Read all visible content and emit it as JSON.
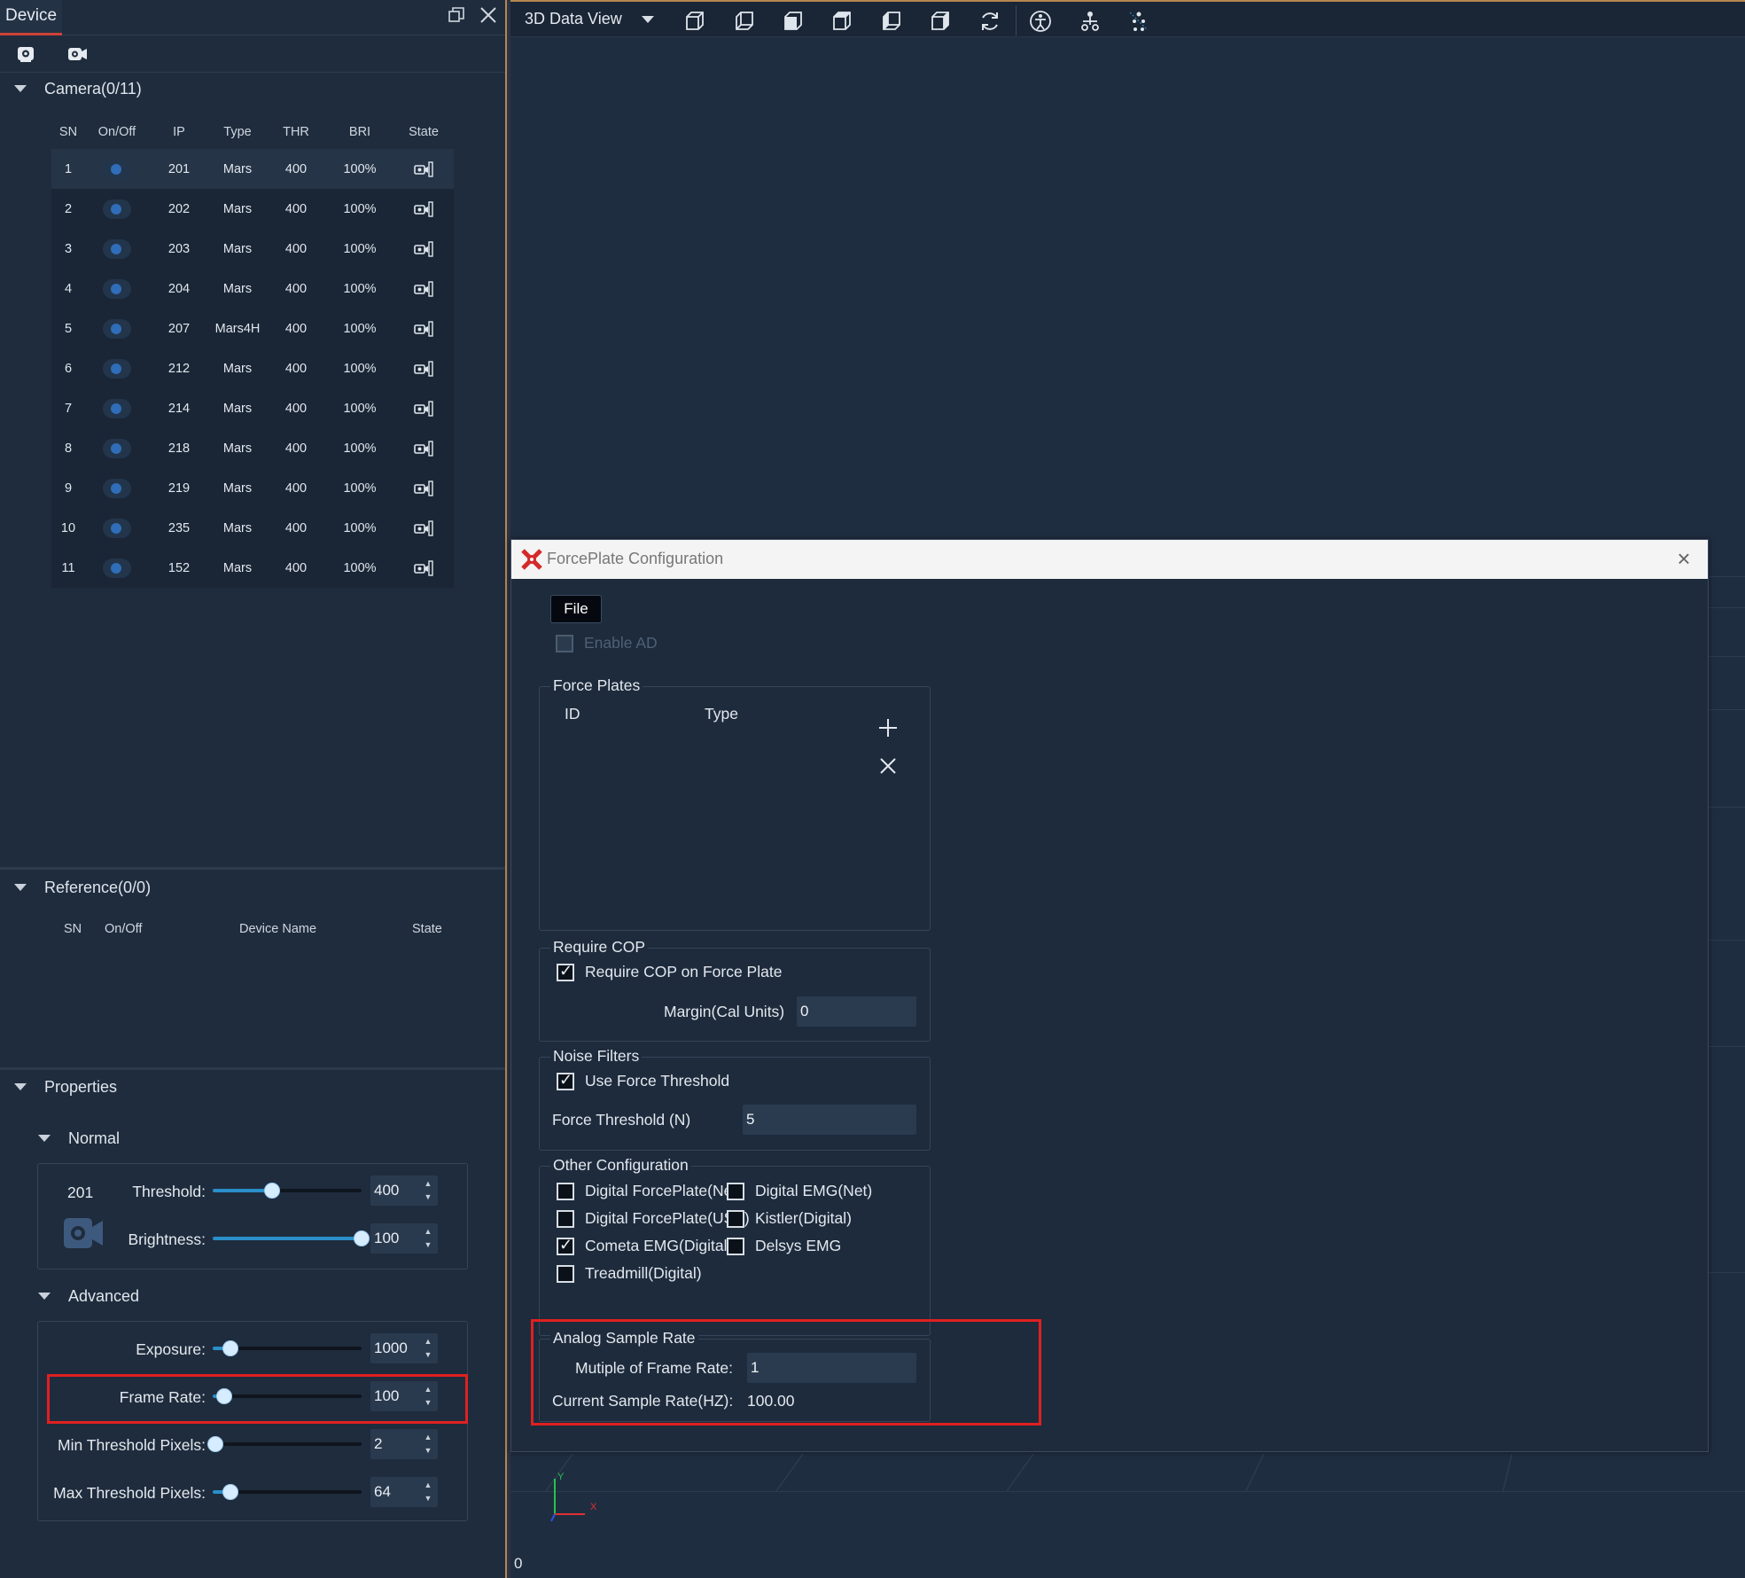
{
  "left_panel": {
    "tab_title": "Device",
    "camera_section": {
      "title": "Camera(0/11)",
      "columns": [
        "SN",
        "On/Off",
        "IP",
        "Type",
        "THR",
        "BRI",
        "State"
      ],
      "rows": [
        {
          "sn": "1",
          "ip": "201",
          "type": "Mars",
          "thr": "400",
          "bri": "100%"
        },
        {
          "sn": "2",
          "ip": "202",
          "type": "Mars",
          "thr": "400",
          "bri": "100%"
        },
        {
          "sn": "3",
          "ip": "203",
          "type": "Mars",
          "thr": "400",
          "bri": "100%"
        },
        {
          "sn": "4",
          "ip": "204",
          "type": "Mars",
          "thr": "400",
          "bri": "100%"
        },
        {
          "sn": "5",
          "ip": "207",
          "type": "Mars4H",
          "thr": "400",
          "bri": "100%"
        },
        {
          "sn": "6",
          "ip": "212",
          "type": "Mars",
          "thr": "400",
          "bri": "100%"
        },
        {
          "sn": "7",
          "ip": "214",
          "type": "Mars",
          "thr": "400",
          "bri": "100%"
        },
        {
          "sn": "8",
          "ip": "218",
          "type": "Mars",
          "thr": "400",
          "bri": "100%"
        },
        {
          "sn": "9",
          "ip": "219",
          "type": "Mars",
          "thr": "400",
          "bri": "100%"
        },
        {
          "sn": "10",
          "ip": "235",
          "type": "Mars",
          "thr": "400",
          "bri": "100%"
        },
        {
          "sn": "11",
          "ip": "152",
          "type": "Mars",
          "thr": "400",
          "bri": "100%"
        }
      ]
    },
    "reference_section": {
      "title": "Reference(0/0)",
      "columns": [
        "SN",
        "On/Off",
        "Device Name",
        "State"
      ]
    },
    "properties": {
      "title": "Properties",
      "normal": {
        "title": "Normal",
        "camera_id": "201",
        "threshold_label": "Threshold:",
        "threshold_value": "400",
        "threshold_level": 0.4,
        "brightness_label": "Brightness:",
        "brightness_value": "100",
        "brightness_level": 1.0
      },
      "advanced": {
        "title": "Advanced",
        "exposure_label": "Exposure:",
        "exposure_value": "1000",
        "exposure_level": 0.12,
        "frame_rate_label": "Frame Rate:",
        "frame_rate_value": "100",
        "frame_rate_level": 0.08,
        "min_threshold_label": "Min Threshold Pixels:",
        "min_threshold_value": "2",
        "min_threshold_level": 0.02,
        "max_threshold_label": "Max Threshold Pixels:",
        "max_threshold_value": "64",
        "max_threshold_level": 0.12
      }
    }
  },
  "view": {
    "mode_label": "3D Data View",
    "axis_zero": "0",
    "axis_x": "X",
    "axis_y": "Y"
  },
  "dialog": {
    "title": "ForcePlate Configuration",
    "file_menu": "File",
    "enable_ad": "Enable AD",
    "force_plates": {
      "title": "Force Plates",
      "col_id": "ID",
      "col_type": "Type"
    },
    "require_cop": {
      "title": "Require COP",
      "checkbox": "Require COP on Force Plate",
      "margin_label": "Margin(Cal Units)",
      "margin_value": "0"
    },
    "noise_filters": {
      "title": "Noise Filters",
      "checkbox": "Use Force Threshold",
      "threshold_label": "Force Threshold (N)",
      "threshold_value": "5"
    },
    "other_config": {
      "title": "Other Configuration",
      "items": [
        {
          "label": "Digital ForcePlate(Net)",
          "checked": false
        },
        {
          "label": "Digital EMG(Net)",
          "checked": false
        },
        {
          "label": "Digital ForcePlate(USB)",
          "checked": false
        },
        {
          "label": "Kistler(Digital)",
          "checked": false
        },
        {
          "label": "Cometa EMG(Digital)",
          "checked": true
        },
        {
          "label": "Delsys EMG",
          "checked": false
        },
        {
          "label": "Treadmill(Digital)",
          "checked": false
        }
      ]
    },
    "analog": {
      "title": "Analog Sample Rate",
      "multiple_label": "Mutiple of Frame Rate:",
      "multiple_value": "1",
      "current_label": "Current Sample Rate(HZ):",
      "current_value": "100.00"
    }
  },
  "colors": {
    "accent": "#2a8fc9",
    "highlight": "#e02020",
    "tab_underline": "#d0423a"
  },
  "icons": [
    "restore-icon",
    "close-icon",
    "camera-eye-icon",
    "video-eye-icon",
    "collapse-triangle-icon",
    "camera-state-icon",
    "video-camera-icon",
    "cube-icons",
    "refresh-icon",
    "skeleton-icon",
    "forceplate-logo-icon",
    "plus-icon"
  ]
}
